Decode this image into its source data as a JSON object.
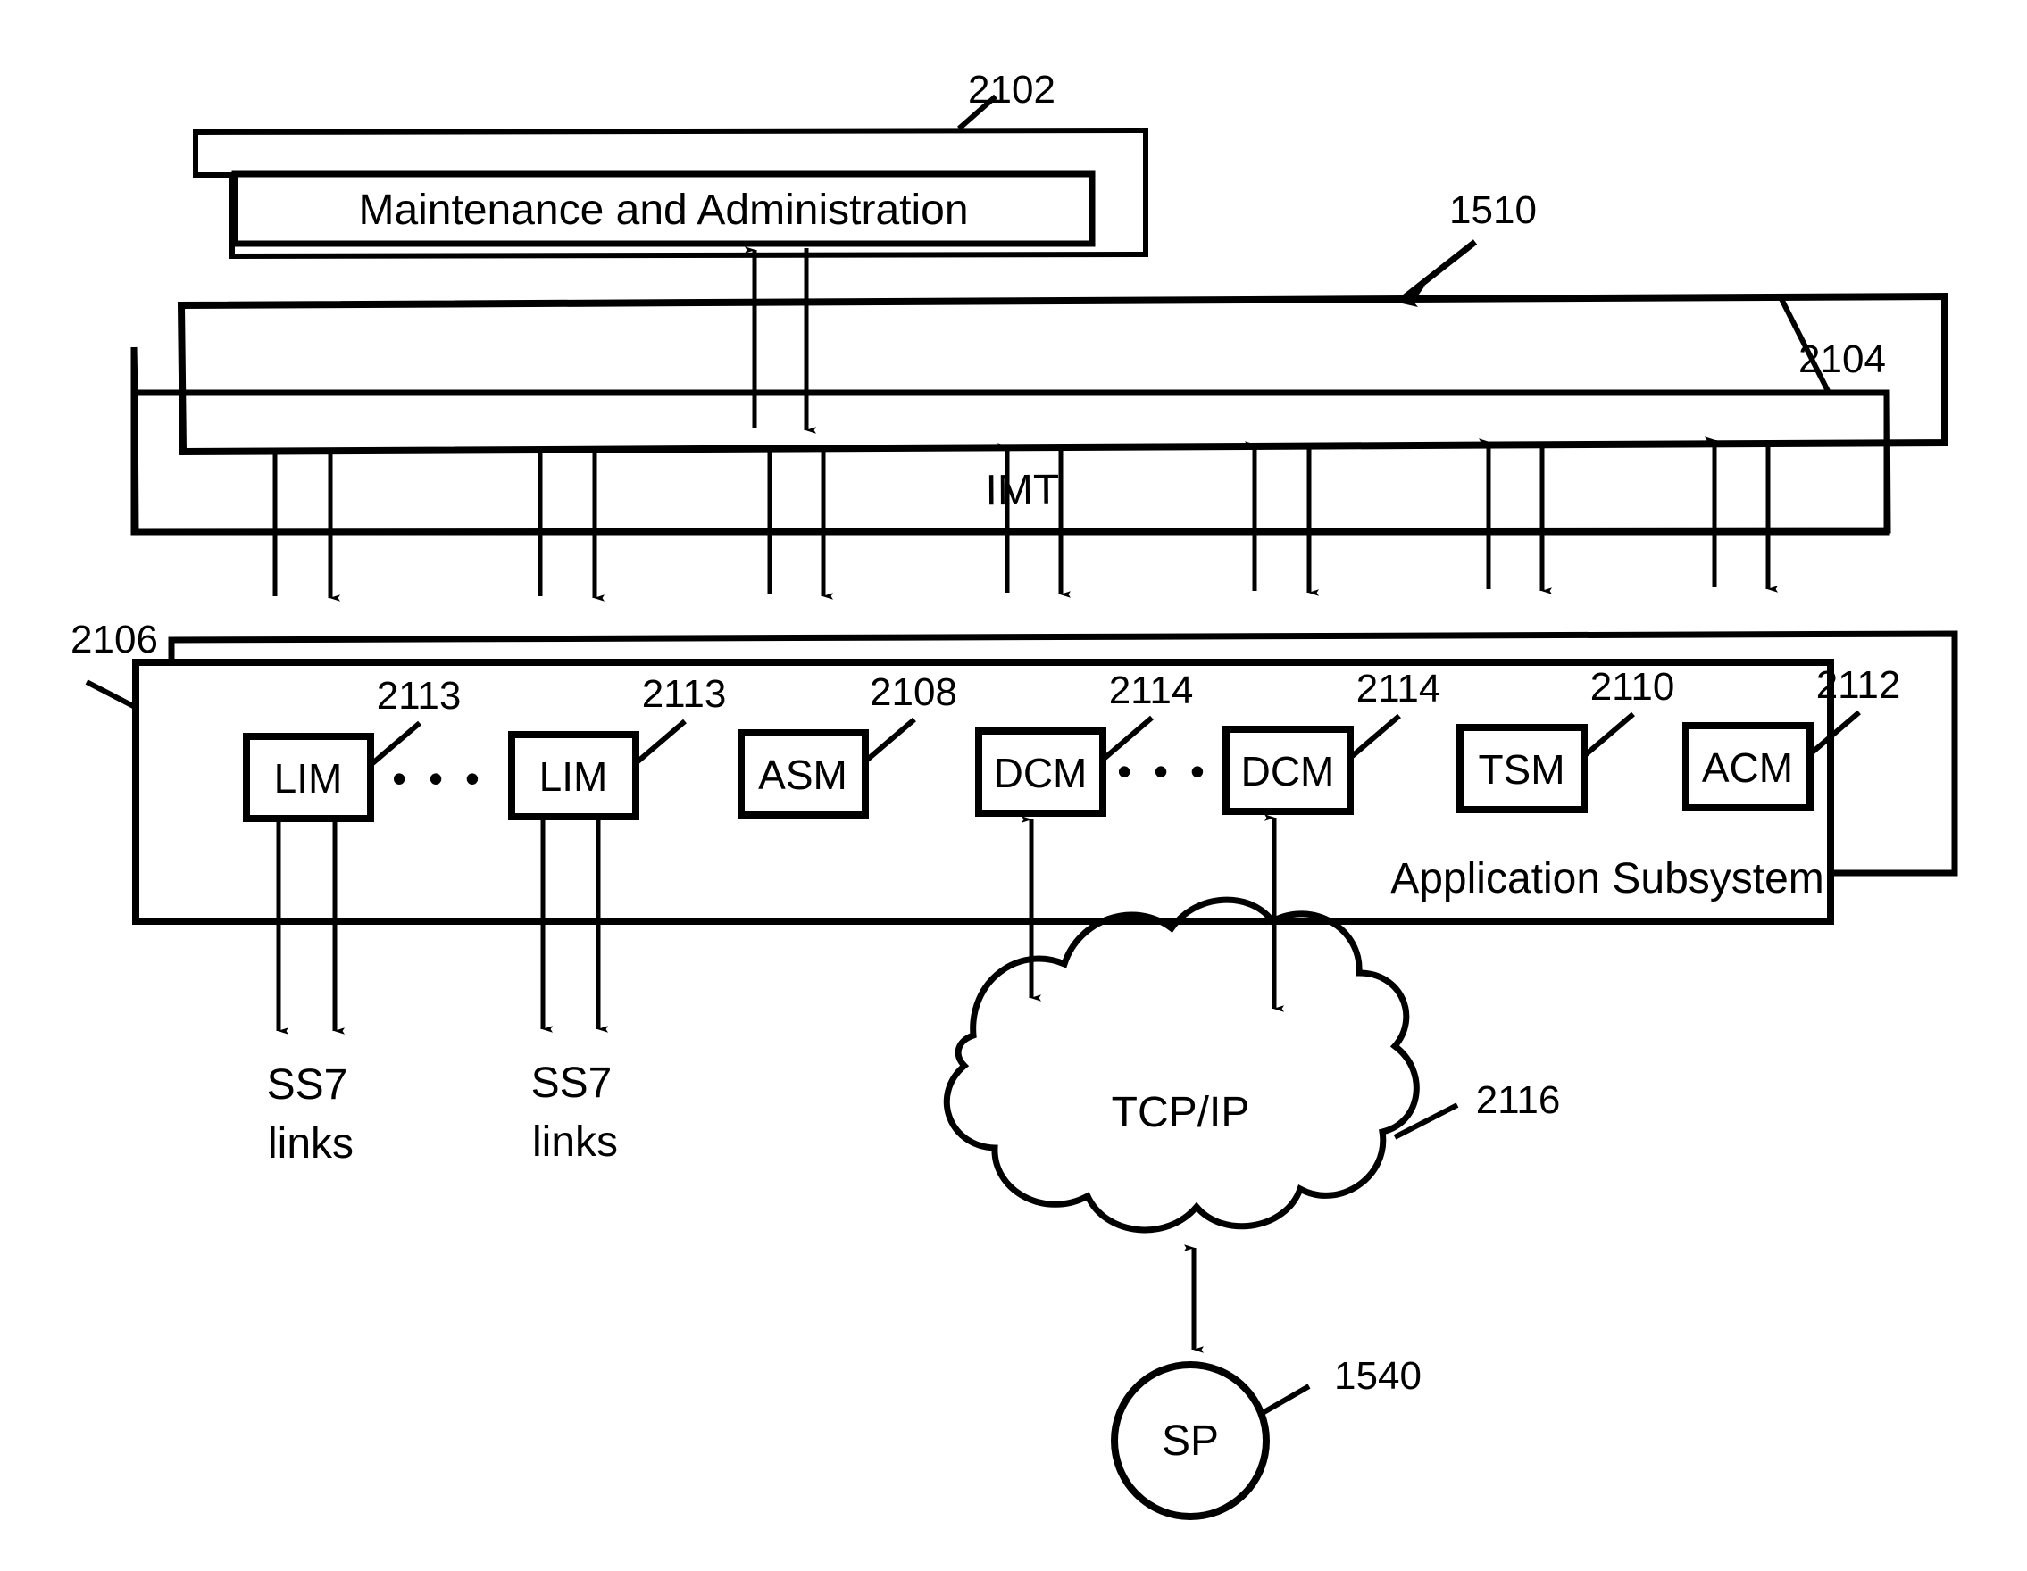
{
  "figure": {
    "type": "patent-block-diagram",
    "overall_ref": "1510",
    "background": "#ffffff",
    "line_color": "#000000"
  },
  "blocks": {
    "maintenance": {
      "label": "Maintenance and Administration",
      "ref": "2102"
    },
    "imt": {
      "label": "IMT",
      "ref": "2104"
    },
    "application_subsystem": {
      "label": "Application Subsystem",
      "ref": "2106"
    },
    "cloud": {
      "label": "TCP/IP",
      "ref": "2116"
    },
    "sp": {
      "label": "SP",
      "ref": "1540"
    }
  },
  "modules": [
    {
      "label": "LIM",
      "ref": "2113"
    },
    {
      "label": "LIM",
      "ref": "2113"
    },
    {
      "label": "ASM",
      "ref": "2108"
    },
    {
      "label": "DCM",
      "ref": "2114"
    },
    {
      "label": "DCM",
      "ref": "2114"
    },
    {
      "label": "TSM",
      "ref": "2110"
    },
    {
      "label": "ACM",
      "ref": "2112"
    }
  ],
  "ellipses": [
    {
      "name": "lim-ellipsis",
      "glyph": "• • •"
    },
    {
      "name": "dcm-ellipsis",
      "glyph": "• • •"
    }
  ],
  "link_labels": [
    {
      "line1": "SS7",
      "line2": "links"
    },
    {
      "line1": "SS7",
      "line2": "links"
    }
  ],
  "reference_numerals": {
    "maintenance": "2102",
    "overall": "1510",
    "imt": "2104",
    "application_subsystem": "2106",
    "lim_a": "2113",
    "lim_b": "2113",
    "asm": "2108",
    "dcm_a": "2114",
    "dcm_b": "2114",
    "tsm": "2110",
    "acm": "2112",
    "cloud": "2116",
    "sp": "1540"
  }
}
